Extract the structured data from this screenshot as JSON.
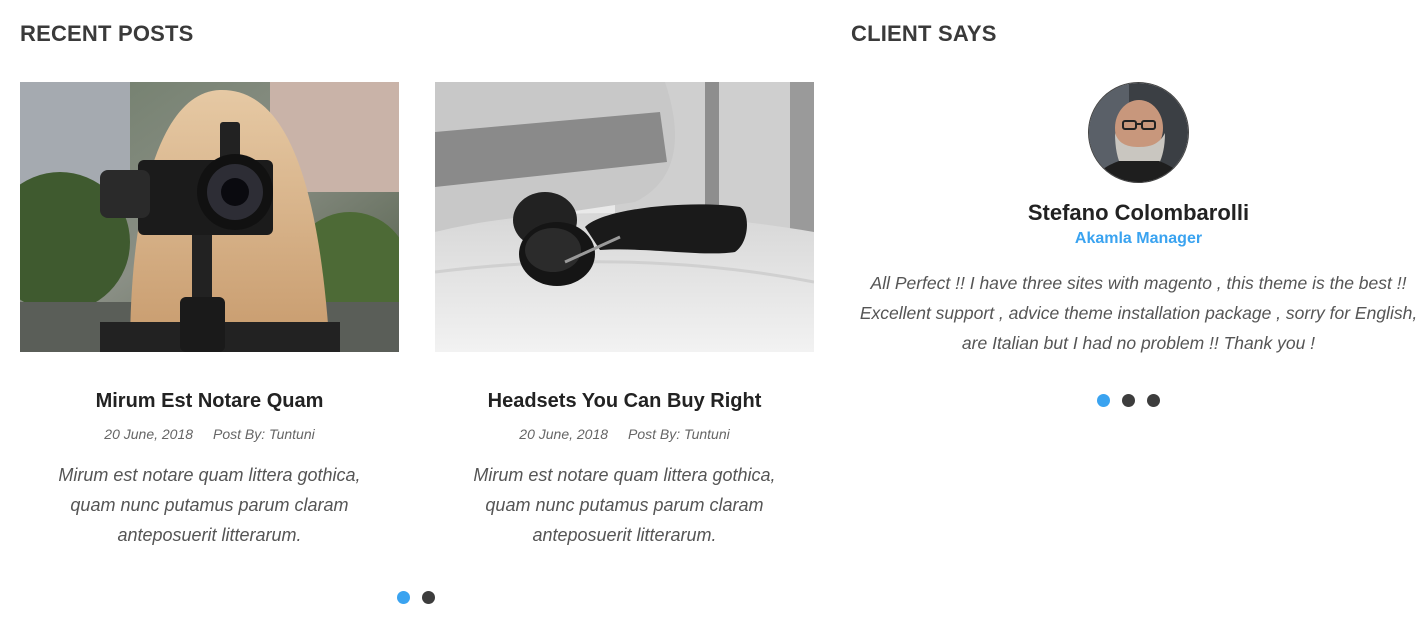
{
  "recent_posts": {
    "title": "RECENT POSTS",
    "posts": [
      {
        "title": "Mirum Est Notare Quam",
        "date": "20 June, 2018",
        "author": "Post By: Tuntuni",
        "excerpt": "Mirum est notare quam littera gothica, quam nunc putamus parum claram anteposuerit litterarum.",
        "image": "woman-holding-camera-photo"
      },
      {
        "title": "Headsets You Can Buy Right",
        "date": "20 June, 2018",
        "author": "Post By: Tuntuni",
        "excerpt": "Mirum est notare quam littera gothica, quam nunc putamus parum claram anteposuerit litterarum.",
        "image": "headphones-on-pillow-photo"
      }
    ],
    "pagination": {
      "count": 2,
      "active": 0
    }
  },
  "client_says": {
    "title": "CLIENT SAYS",
    "name": "Stefano Colombarolli",
    "role": "Akamla Manager",
    "quote": "All Perfect !! I have three sites with magento , this theme is the best !! Excellent support , advice theme installation package , sorry for English, are Italian but I had no problem !! Thank you !",
    "avatar": "bearded-man-portrait",
    "pagination": {
      "count": 3,
      "active": 0
    }
  },
  "colors": {
    "accent": "#3aa3f0",
    "dot_inactive": "#3d3d3d",
    "heading": "#3a3a3a"
  }
}
